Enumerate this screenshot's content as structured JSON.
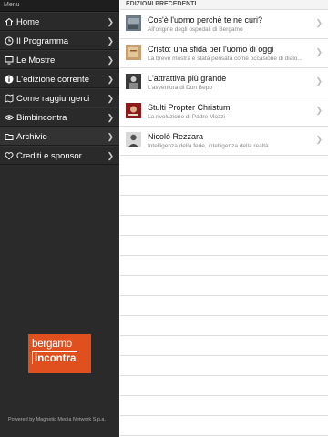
{
  "sidebar": {
    "header": "Menu",
    "items": [
      {
        "label": "Home",
        "icon": "home-icon"
      },
      {
        "label": "Il Programma",
        "icon": "clock-icon"
      },
      {
        "label": "Le Mostre",
        "icon": "screen-icon"
      },
      {
        "label": "L'edizione corrente",
        "icon": "info-icon"
      },
      {
        "label": "Come raggiungerci",
        "icon": "map-icon"
      },
      {
        "label": "Bimbincontra",
        "icon": "eye-icon"
      },
      {
        "label": "Archivio",
        "icon": "folder-icon"
      },
      {
        "label": "Crediti e sponsor",
        "icon": "heart-icon"
      }
    ],
    "logo_line1": "bergamo",
    "logo_line2": "incontra",
    "powered": "Powered by Magnetic Media Network S.p.a."
  },
  "main": {
    "section_title": "EDIZIONI PRECEDENTI",
    "rows": [
      {
        "title": "Cos'è l'uomo perchè te ne curi?",
        "subtitle": "All'origine degli ospedali di Bergamo",
        "thumb": "painting-thumb"
      },
      {
        "title": "Cristo: una sfida per l'uomo di oggi",
        "subtitle": "La breve mostra è stata pensata come occasione di dialo...",
        "thumb": "book-thumb"
      },
      {
        "title": "L'attrattiva più grande",
        "subtitle": "L'avventura di Don Bepo",
        "thumb": "photo-thumb"
      },
      {
        "title": "Stulti Propter Christum",
        "subtitle": "La rivoluzione di Padre Mozzi",
        "thumb": "red-cover-thumb"
      },
      {
        "title": "Nicolò Rezzara",
        "subtitle": "Intelligenza della fede, intelligenza della realtà",
        "thumb": "portrait-thumb"
      }
    ]
  }
}
